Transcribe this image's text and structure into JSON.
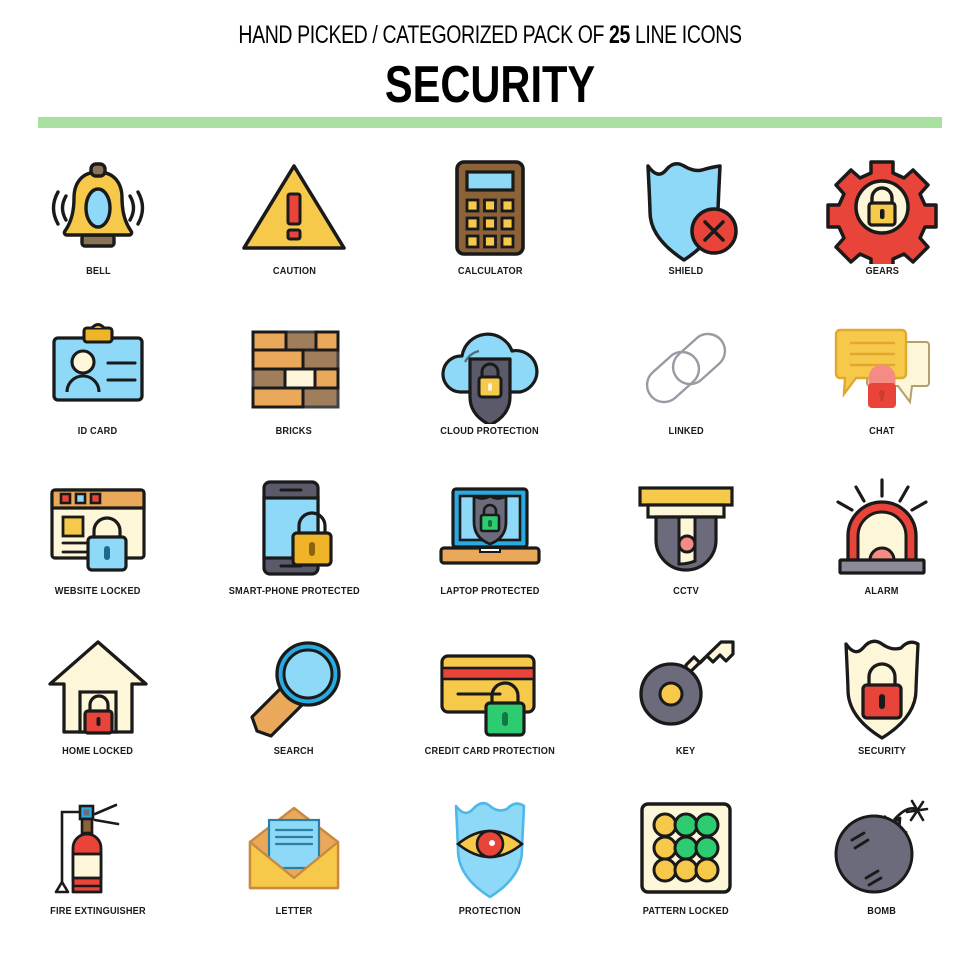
{
  "header": {
    "tagline_pre": "HAND PICKED / CATEGORIZED PACK OF ",
    "tagline_count": "25",
    "tagline_post": " LINE ICONS",
    "title": "SECURITY",
    "rule_color": "#a8e0a0"
  },
  "palette": {
    "outline": "#1a1a1a",
    "yellow": "#f7c94b",
    "yellow_light": "#fcf3c8",
    "yellow_deep": "#f0b429",
    "blue_light": "#8ed8f8",
    "blue": "#29abe2",
    "red": "#e8443a",
    "red_light": "#f58c83",
    "green": "#2ecc71",
    "green_dark": "#27ae60",
    "gray_blue": "#6b6b7b",
    "brown": "#8c6239",
    "tan": "#eaa95a",
    "cream": "#fdf6d8"
  },
  "icons": [
    [
      {
        "id": "bell",
        "label": "BELL"
      },
      {
        "id": "caution",
        "label": "CAUTION"
      },
      {
        "id": "calculator",
        "label": "CALCULATOR"
      },
      {
        "id": "shield-x",
        "label": "SHIELD"
      },
      {
        "id": "gears",
        "label": "GEARS"
      }
    ],
    [
      {
        "id": "id-card",
        "label": "ID CARD"
      },
      {
        "id": "bricks",
        "label": "BRICKS"
      },
      {
        "id": "cloud-protection",
        "label": "CLOUD PROTECTION"
      },
      {
        "id": "linked",
        "label": "LINKED"
      },
      {
        "id": "chat",
        "label": "CHAT"
      }
    ],
    [
      {
        "id": "website-locked",
        "label": "WEBSITE LOCKED"
      },
      {
        "id": "smartphone",
        "label": "SMART-PHONE PROTECTED"
      },
      {
        "id": "laptop",
        "label": "LAPTOP PROTECTED"
      },
      {
        "id": "cctv",
        "label": "CCTV"
      },
      {
        "id": "alarm",
        "label": "ALARM"
      }
    ],
    [
      {
        "id": "home-locked",
        "label": "HOME LOCKED"
      },
      {
        "id": "search",
        "label": "SEARCH"
      },
      {
        "id": "credit-card",
        "label": "CREDIT CARD PROTECTION"
      },
      {
        "id": "key",
        "label": "KEY"
      },
      {
        "id": "security-shield",
        "label": "SECURITY"
      }
    ],
    [
      {
        "id": "fire-extinguisher",
        "label": "FIRE EXTINGUISHER"
      },
      {
        "id": "letter",
        "label": "LETTER"
      },
      {
        "id": "protection-eye",
        "label": "PROTECTION"
      },
      {
        "id": "pattern-locked",
        "label": "PATTERN LOCKED"
      },
      {
        "id": "bomb",
        "label": "BOMB"
      }
    ]
  ]
}
